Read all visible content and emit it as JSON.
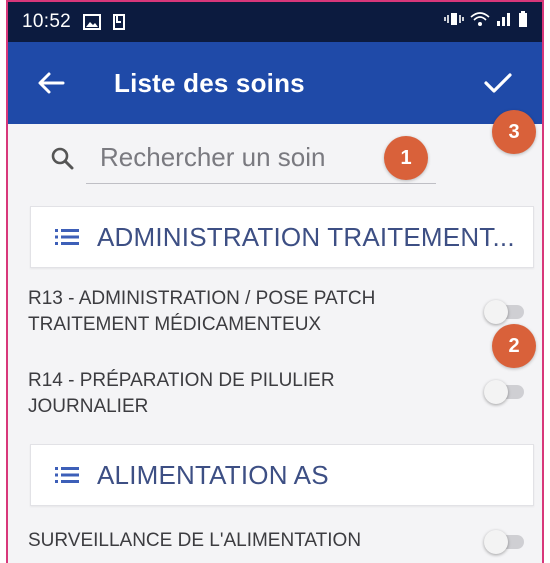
{
  "status_bar": {
    "time": "10:52"
  },
  "app_bar": {
    "title": "Liste des soins"
  },
  "search": {
    "placeholder": "Rechercher un soin"
  },
  "annotations": {
    "badge_1": "1",
    "badge_2": "2",
    "badge_3": "3"
  },
  "categories": [
    {
      "label": "ADMINISTRATION TRAITEMENT...",
      "items": [
        {
          "label": "R13 - ADMINISTRATION / POSE PATCH TRAITEMENT MÉDICAMENTEUX",
          "enabled": false
        },
        {
          "label": "R14 - PRÉPARATION DE PILULIER JOURNALIER",
          "enabled": false
        }
      ]
    },
    {
      "label": "ALIMENTATION AS",
      "items": [
        {
          "label": "SURVEILLANCE DE L'ALIMENTATION",
          "enabled": false
        }
      ]
    }
  ],
  "colors": {
    "status_bar": "#0c1b3f",
    "app_bar": "#1f4aa8",
    "badge": "#d9613a",
    "category_text": "#3d4f84",
    "frame_border": "#d8377a"
  }
}
